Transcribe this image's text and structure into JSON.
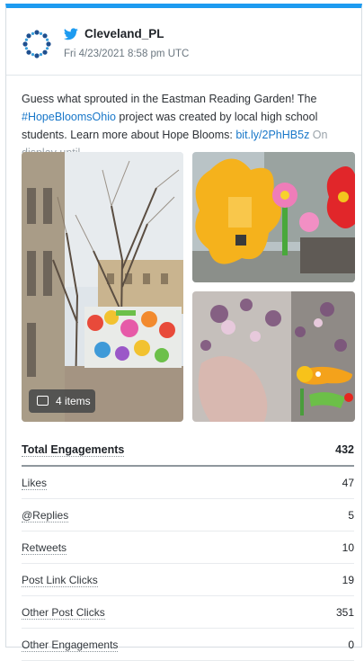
{
  "account": {
    "handle": "Cleveland_PL",
    "timestamp": "Fri 4/23/2021 8:58 pm UTC"
  },
  "tweet": {
    "text_1": "Guess what sprouted in the Eastman Reading Garden! The ",
    "hashtag": "#HopeBloomsOhio",
    "text_2": " project was created by local high school students. Learn more about Hope Blooms: ",
    "link": "bit.ly/2PhHB5z",
    "text_3": " On display until"
  },
  "media": {
    "items_label": "4 items"
  },
  "engagements": {
    "header": {
      "label": "Total Engagements",
      "value": "432"
    },
    "rows": [
      {
        "label": "Likes",
        "value": "47"
      },
      {
        "label": "@Replies",
        "value": "5"
      },
      {
        "label": "Retweets",
        "value": "10"
      },
      {
        "label": "Post Link Clicks",
        "value": "19"
      },
      {
        "label": "Other Post Clicks",
        "value": "351"
      },
      {
        "label": "Other Engagements",
        "value": "0"
      }
    ]
  },
  "colors": {
    "accent": "#1d9bf0",
    "link": "#1877c9"
  },
  "icons": {
    "avatar": "library-logo-icon",
    "platform": "twitter-bird-icon",
    "media": "image-icon"
  }
}
